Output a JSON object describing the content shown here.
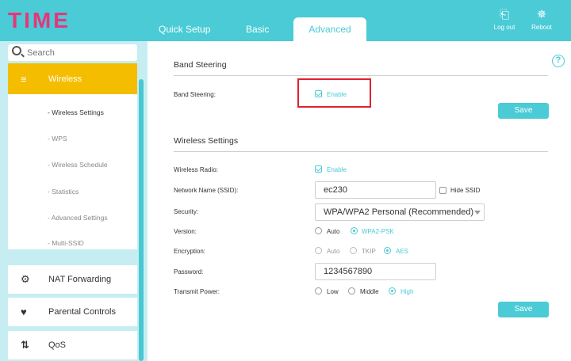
{
  "brand": {
    "logo_text": "TIME",
    "accent": "#4acbd6",
    "logo_color": "#e8357a",
    "active_menu_color": "#f5bd00",
    "highlight_color": "#e0202c"
  },
  "header": {
    "tabs": [
      {
        "label": "Quick Setup"
      },
      {
        "label": "Basic"
      },
      {
        "label": "Advanced"
      }
    ],
    "logout_label": "Log out",
    "reboot_label": "Reboot"
  },
  "sidebar": {
    "search_placeholder": "Search",
    "wireless_label": "Wireless",
    "subitems": [
      {
        "label": "- Wireless Settings"
      },
      {
        "label": "- WPS"
      },
      {
        "label": "- Wireless Schedule"
      },
      {
        "label": "- Statistics"
      },
      {
        "label": "- Advanced Settings"
      },
      {
        "label": "- Multi-SSID"
      }
    ],
    "nat_label": "NAT Forwarding",
    "parental_label": "Parental Controls",
    "qos_label": "QoS"
  },
  "band_steering": {
    "title": "Band Steering",
    "field_label": "Band Steering:",
    "enable_label": "Enable",
    "save_label": "Save"
  },
  "wireless_settings": {
    "title": "Wireless Settings",
    "radio_label": "Wireless Radio:",
    "radio_enable_label": "Enable",
    "ssid_label": "Network Name (SSID):",
    "ssid_value": "ec230",
    "hide_ssid_label": "Hide SSID",
    "security_label": "Security:",
    "security_value": "WPA/WPA2 Personal (Recommended)",
    "version_label": "Version:",
    "version_auto": "Auto",
    "version_wpa2": "WPA2-PSK",
    "encryption_label": "Encryption:",
    "enc_auto": "Auto",
    "enc_tkip": "TKIP",
    "enc_aes": "AES",
    "password_label": "Password:",
    "password_value": "1234567890",
    "power_label": "Transmit Power:",
    "power_low": "Low",
    "power_middle": "Middle",
    "power_high": "High",
    "save_label": "Save"
  },
  "help_glyph": "?"
}
